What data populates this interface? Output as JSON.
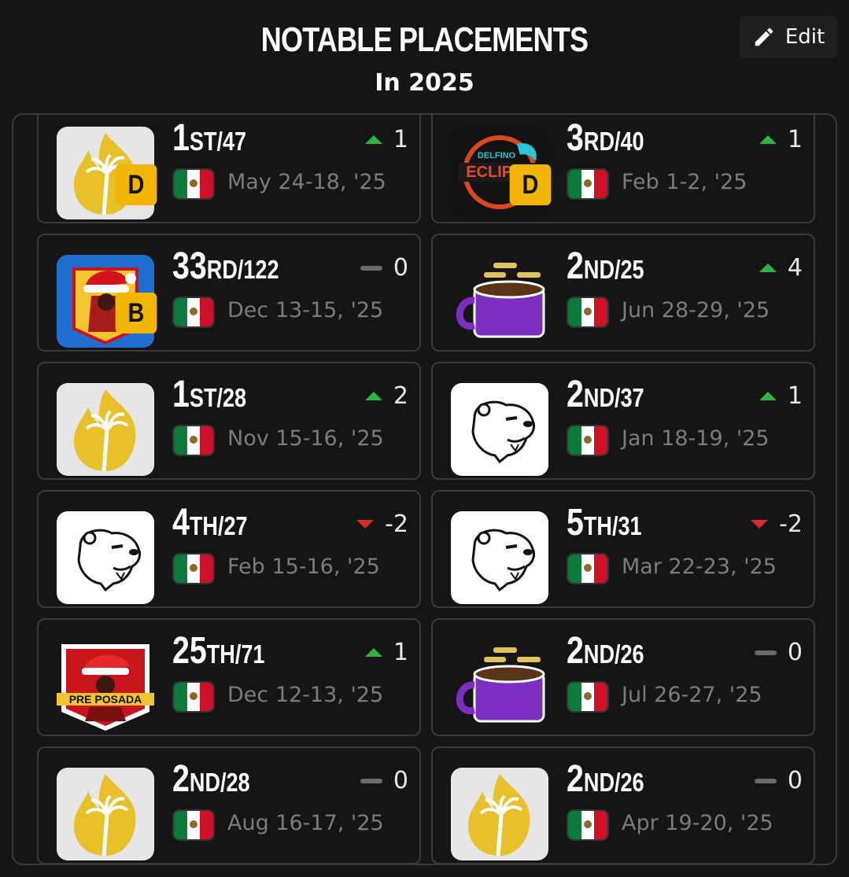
{
  "header": {
    "title": "NOTABLE PLACEMENTS",
    "subtitle": "In 2025",
    "edit_label": "Edit"
  },
  "colors": {
    "up": "#2fb344",
    "down": "#d92b2b",
    "flat": "#6a6a6a",
    "badge": "#f2b600"
  },
  "placements": [
    {
      "logo": "palm-flame",
      "badge": "D",
      "place": "1",
      "suffix": "ST/47",
      "trend": "up",
      "delta": "1",
      "flag": "mexico",
      "date": "May 24-18, '25"
    },
    {
      "logo": "delfino-eclipse",
      "logo_text": "DELFINO ECLIPSE",
      "badge": "D",
      "place": "3",
      "suffix": "RD/40",
      "trend": "up",
      "delta": "1",
      "flag": "mexico",
      "date": "Feb 1-2, '25"
    },
    {
      "logo": "santa-character",
      "badge": "B",
      "place": "33",
      "suffix": "RD/122",
      "trend": "flat",
      "delta": "0",
      "flag": "mexico",
      "date": "Dec 13-15, '25"
    },
    {
      "logo": "coffee-pot",
      "badge": "",
      "place": "2",
      "suffix": "ND/25",
      "trend": "up",
      "delta": "4",
      "flag": "mexico",
      "date": "Jun 28-29, '25"
    },
    {
      "logo": "palm-flame",
      "badge": "",
      "place": "1",
      "suffix": "ST/28",
      "trend": "up",
      "delta": "2",
      "flag": "mexico",
      "date": "Nov 15-16, '25"
    },
    {
      "logo": "bear-head",
      "badge": "",
      "place": "2",
      "suffix": "ND/37",
      "trend": "up",
      "delta": "1",
      "flag": "mexico",
      "date": "Jan 18-19, '25"
    },
    {
      "logo": "bear-head",
      "badge": "",
      "place": "4",
      "suffix": "TH/27",
      "trend": "down",
      "delta": "-2",
      "flag": "mexico",
      "date": "Feb 15-16, '25"
    },
    {
      "logo": "bear-head",
      "badge": "",
      "place": "5",
      "suffix": "TH/31",
      "trend": "down",
      "delta": "-2",
      "flag": "mexico",
      "date": "Mar 22-23, '25"
    },
    {
      "logo": "pre-posada",
      "logo_text": "PRE POSADA",
      "badge": "",
      "place": "25",
      "suffix": "TH/71",
      "trend": "up",
      "delta": "1",
      "flag": "mexico",
      "date": "Dec 12-13, '25"
    },
    {
      "logo": "coffee-pot",
      "badge": "",
      "place": "2",
      "suffix": "ND/26",
      "trend": "flat",
      "delta": "0",
      "flag": "mexico",
      "date": "Jul 26-27, '25"
    },
    {
      "logo": "palm-flame",
      "badge": "",
      "place": "2",
      "suffix": "ND/28",
      "trend": "flat",
      "delta": "0",
      "flag": "mexico",
      "date": "Aug 16-17, '25"
    },
    {
      "logo": "palm-flame",
      "badge": "",
      "place": "2",
      "suffix": "ND/26",
      "trend": "flat",
      "delta": "0",
      "flag": "mexico",
      "date": "Apr 19-20, '25"
    }
  ]
}
